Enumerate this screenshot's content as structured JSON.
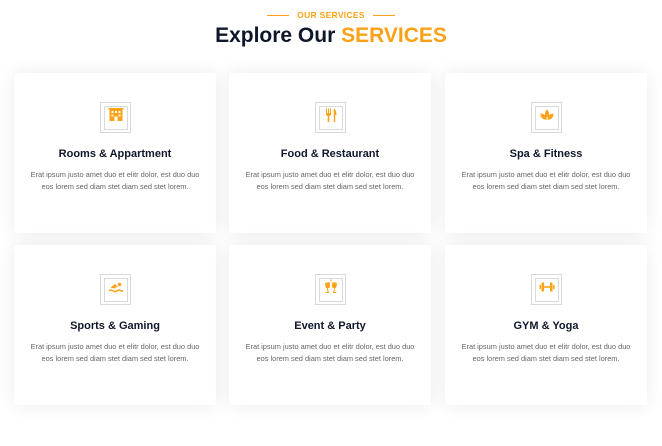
{
  "section": {
    "subtitle": "OUR SERVICES",
    "title_main": "Explore Our",
    "title_accent": "SERVICES"
  },
  "colors": {
    "accent": "#FEA116",
    "dark": "#0F172B",
    "text": "#666565"
  },
  "services": [
    {
      "title": "Rooms & Appartment",
      "text": "Erat ipsum justo amet duo et elitr dolor, est duo duo eos lorem sed diam stet diam sed stet lorem.",
      "icon": "hotel-icon"
    },
    {
      "title": "Food & Restaurant",
      "text": "Erat ipsum justo amet duo et elitr dolor, est duo duo eos lorem sed diam stet diam sed stet lorem.",
      "icon": "utensils-icon"
    },
    {
      "title": "Spa & Fitness",
      "text": "Erat ipsum justo amet duo et elitr dolor, est duo duo eos lorem sed diam stet diam sed stet lorem.",
      "icon": "spa-icon"
    },
    {
      "title": "Sports & Gaming",
      "text": "Erat ipsum justo amet duo et elitr dolor, est duo duo eos lorem sed diam stet diam sed stet lorem.",
      "icon": "swimmer-icon"
    },
    {
      "title": "Event & Party",
      "text": "Erat ipsum justo amet duo et elitr dolor, est duo duo eos lorem sed diam stet diam sed stet lorem.",
      "icon": "glass-cheers-icon"
    },
    {
      "title": "GYM & Yoga",
      "text": "Erat ipsum justo amet duo et elitr dolor, est duo duo eos lorem sed diam stet diam sed stet lorem.",
      "icon": "dumbbell-icon"
    }
  ]
}
